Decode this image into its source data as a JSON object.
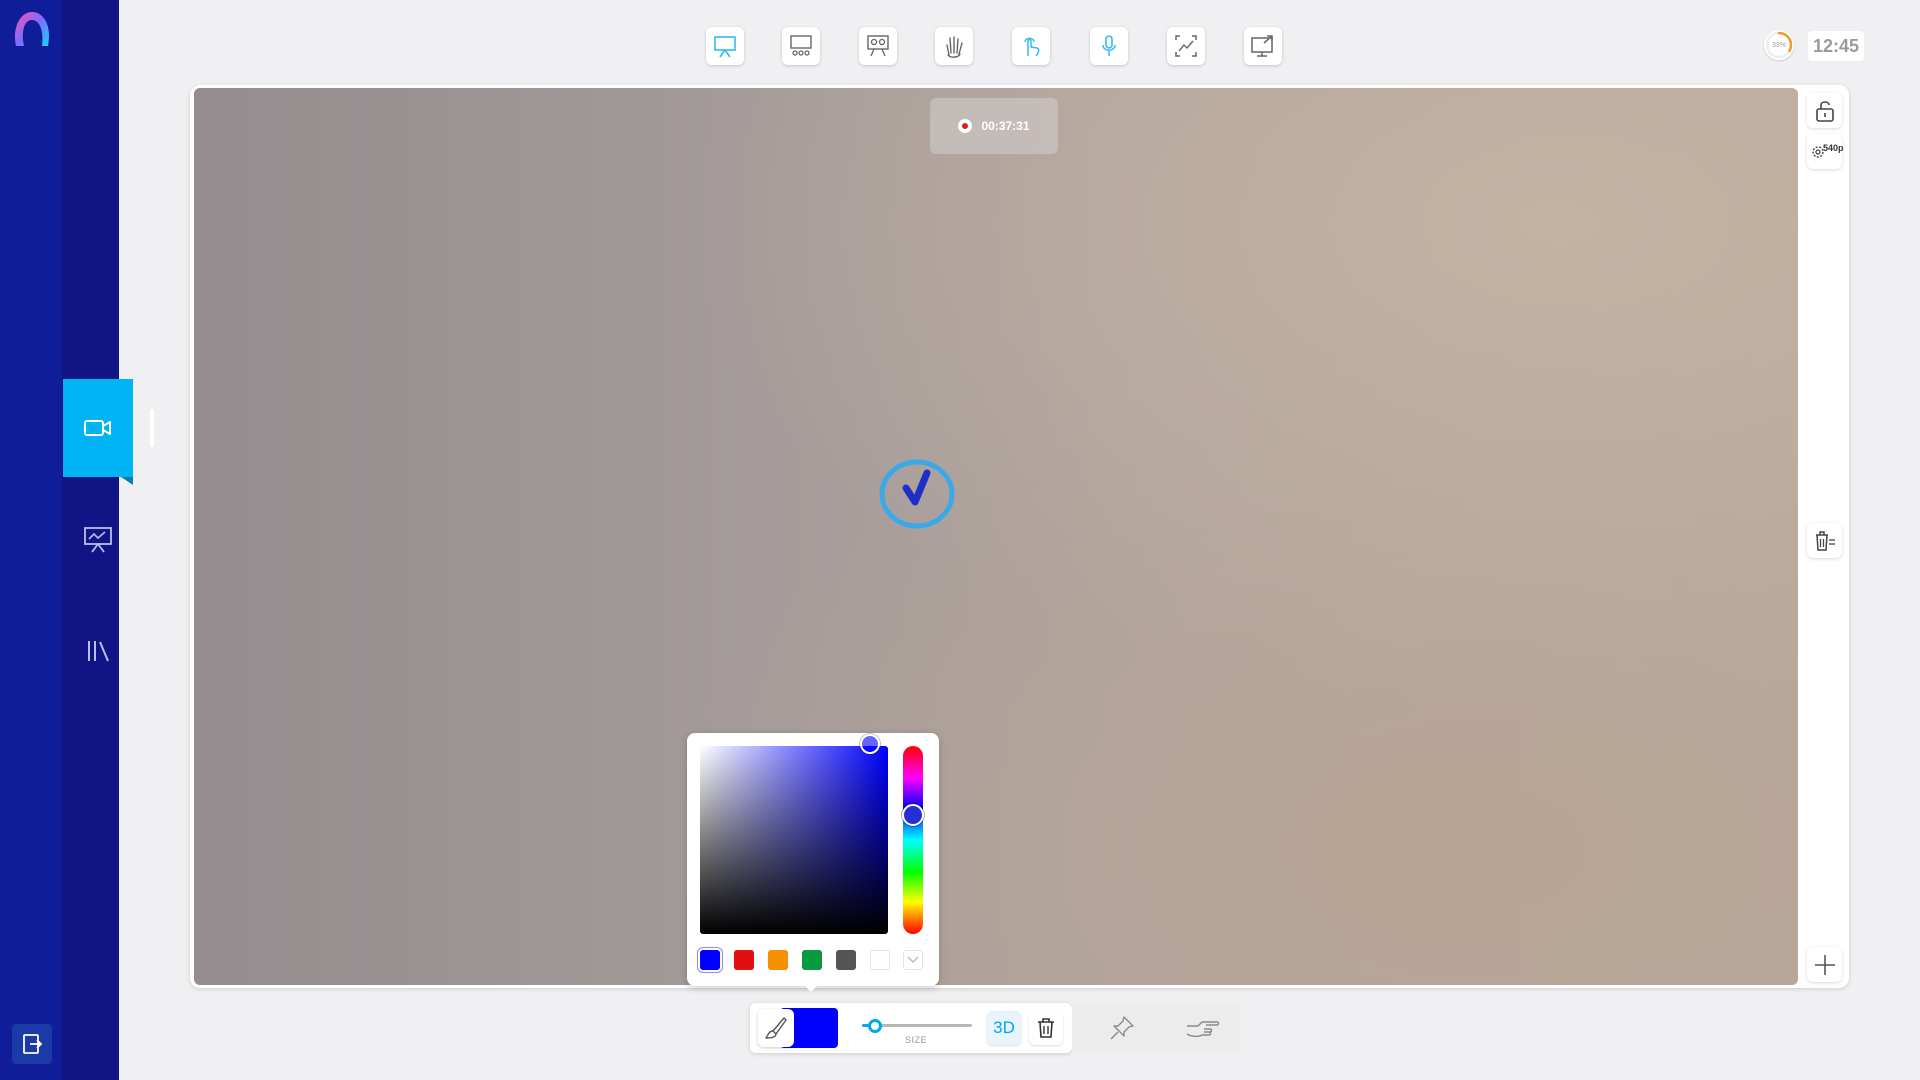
{
  "sidebar": {
    "items": [
      {
        "name": "video",
        "icon": "video-camera-icon",
        "active": true
      },
      {
        "name": "presentation",
        "icon": "presentation-icon",
        "active": false
      },
      {
        "name": "library",
        "icon": "library-icon",
        "active": false
      }
    ],
    "exit_icon": "exit-icon"
  },
  "top_toolbar": {
    "tools": [
      "whiteboard-icon",
      "class-board-icon",
      "group-board-icon",
      "raise-hand-icon",
      "touch-icon",
      "microphone-icon",
      "screenshot-icon",
      "screen-share-icon"
    ],
    "battery_percent": "33%",
    "battery_level": 0.33,
    "clock": "12:45"
  },
  "video": {
    "recording_time": "00:37:31",
    "resolution_label": "540p"
  },
  "color_picker": {
    "current_color": "#0000ff",
    "swatches": [
      "#0000ff",
      "#e01010",
      "#f59000",
      "#089a40",
      "#555555",
      "#ffffff"
    ]
  },
  "draw_toolbar": {
    "color": "#0000ff",
    "size_label": "SIZE",
    "size_value": 0.12,
    "btn_3d": "3D"
  },
  "colors": {
    "accent": "#00b4f5",
    "sidebar": "#0f1e98"
  }
}
